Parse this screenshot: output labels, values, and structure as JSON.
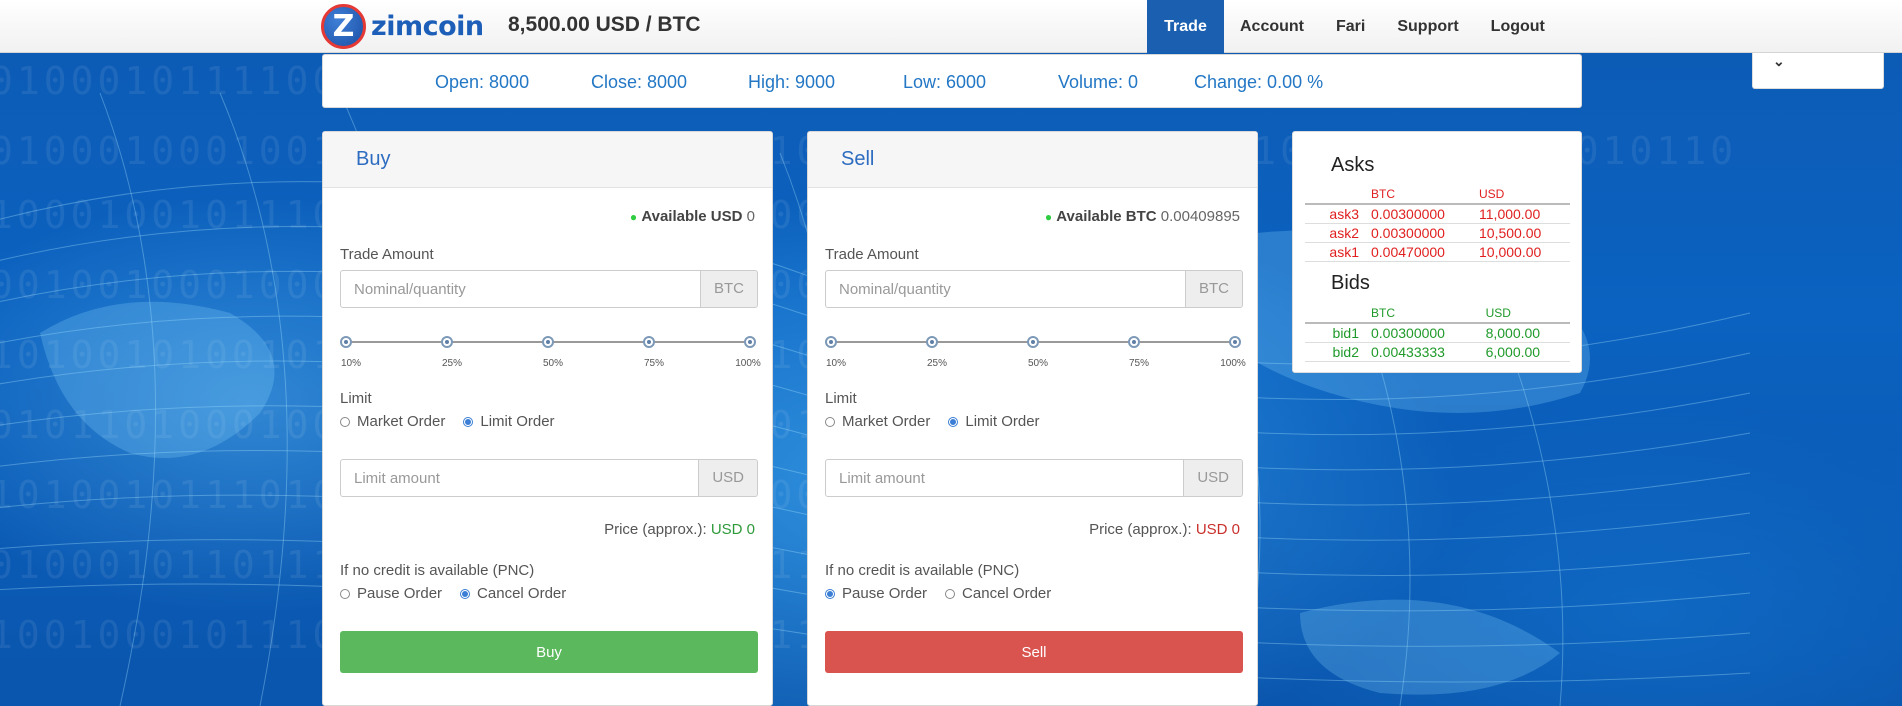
{
  "header": {
    "brand": "zimcoin",
    "logo_letter": "Z",
    "price": "8,500.00 USD / BTC",
    "nav": [
      {
        "label": "Trade",
        "active": true
      },
      {
        "label": "Account"
      },
      {
        "label": "Fari"
      },
      {
        "label": "Support"
      },
      {
        "label": "Logout"
      }
    ]
  },
  "stats": {
    "open": "Open: 8000",
    "close": "Close: 8000",
    "high": "High: 9000",
    "low": "Low: 6000",
    "volume": "Volume: 0",
    "change": "Change: 0.00 %"
  },
  "dropdown": {
    "icon": "chevron-down-icon",
    "glyph": "⌄"
  },
  "buy": {
    "title": "Buy",
    "available_label": "Available USD",
    "available_value": "0",
    "trade_amount_label": "Trade Amount",
    "amount_placeholder": "Nominal/quantity",
    "amount_unit": "BTC",
    "slider_ticks": [
      "10%",
      "25%",
      "50%",
      "75%",
      "100%"
    ],
    "limit_label": "Limit",
    "order_types": [
      "Market Order",
      "Limit Order"
    ],
    "limit_placeholder": "Limit amount",
    "limit_unit": "USD",
    "price_label": "Price (approx.):",
    "price_value": "USD 0",
    "pnc_label": "If no credit is available (PNC)",
    "pnc_options": [
      "Pause Order",
      "Cancel Order"
    ],
    "button": "Buy",
    "button_color": "#5cb85c",
    "price_color": "#2e9a3a"
  },
  "sell": {
    "title": "Sell",
    "available_label": "Available BTC",
    "available_value": "0.00409895",
    "trade_amount_label": "Trade Amount",
    "amount_placeholder": "Nominal/quantity",
    "amount_unit": "BTC",
    "slider_ticks": [
      "10%",
      "25%",
      "50%",
      "75%",
      "100%"
    ],
    "limit_label": "Limit",
    "order_types": [
      "Market Order",
      "Limit Order"
    ],
    "limit_placeholder": "Limit amount",
    "limit_unit": "USD",
    "price_label": "Price (approx.):",
    "price_value": "USD 0",
    "pnc_label": "If no credit is available (PNC)",
    "pnc_options": [
      "Pause Order",
      "Cancel Order"
    ],
    "button": "Sell",
    "button_color": "#d9534f",
    "price_color": "#c9302c"
  },
  "orderbook": {
    "asks_title": "Asks",
    "bids_title": "Bids",
    "col_btc": "BTC",
    "col_usd": "USD",
    "asks": [
      {
        "name": "ask3",
        "btc": "0.00300000",
        "usd": "11,000.00"
      },
      {
        "name": "ask2",
        "btc": "0.00300000",
        "usd": "10,500.00"
      },
      {
        "name": "ask1",
        "btc": "0.00470000",
        "usd": "10,000.00"
      }
    ],
    "bids": [
      {
        "name": "bid1",
        "btc": "0.00300000",
        "usd": "8,000.00"
      },
      {
        "name": "bid2",
        "btc": "0.00433333",
        "usd": "6,000.00"
      }
    ]
  }
}
